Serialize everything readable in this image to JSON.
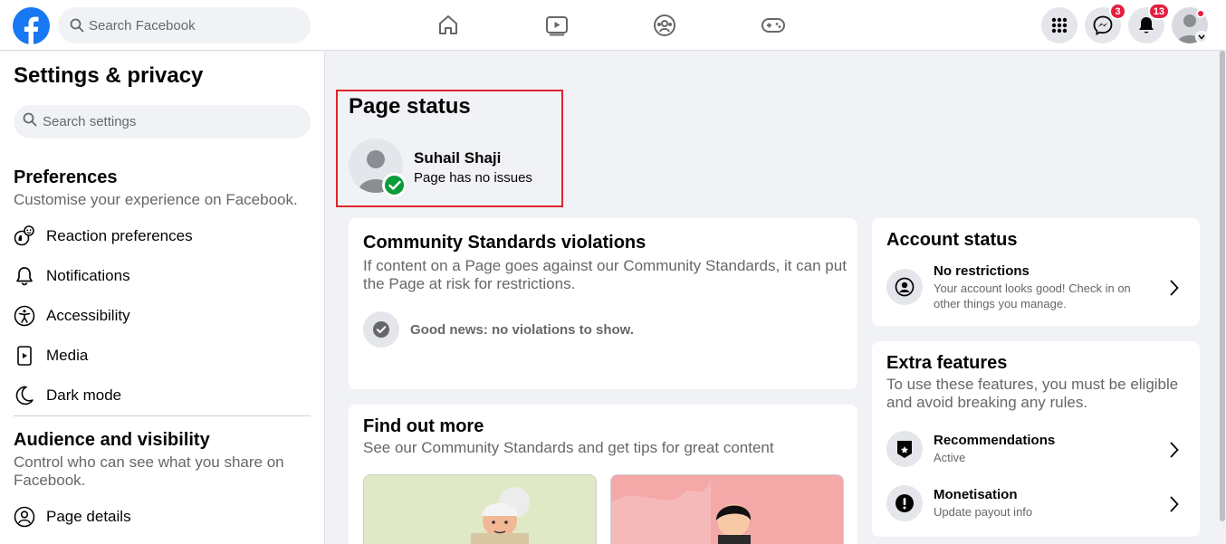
{
  "topbar": {
    "search_placeholder": "Search Facebook",
    "messenger_badge": "3",
    "notifications_badge": "13"
  },
  "sidebar": {
    "title": "Settings & privacy",
    "search_placeholder": "Search settings",
    "preferences": {
      "title": "Preferences",
      "description": "Customise your experience on Facebook.",
      "items": [
        {
          "label": "Reaction preferences",
          "icon": "reaction-icon"
        },
        {
          "label": "Notifications",
          "icon": "bell-icon"
        },
        {
          "label": "Accessibility",
          "icon": "accessibility-icon"
        },
        {
          "label": "Media",
          "icon": "media-icon"
        },
        {
          "label": "Dark mode",
          "icon": "moon-icon"
        }
      ]
    },
    "audience": {
      "title": "Audience and visibility",
      "description": "Control who can see what you share on Facebook.",
      "items": [
        {
          "label": "Page details",
          "icon": "person-icon"
        }
      ]
    }
  },
  "page_status": {
    "title": "Page status",
    "name": "Suhail Shaji",
    "status": "Page has no issues"
  },
  "community": {
    "title": "Community Standards violations",
    "description": "If content on a Page goes against our Community Standards, it can put the Page at risk for restrictions.",
    "good_news": "Good news: no violations to show."
  },
  "find_out_more": {
    "title": "Find out more",
    "description": "See our Community Standards and get tips for great content"
  },
  "account_status": {
    "title": "Account status",
    "row_title": "No restrictions",
    "row_desc": "Your account looks good! Check in on other things you manage."
  },
  "extra_features": {
    "title": "Extra features",
    "description": "To use these features, you must be eligible and avoid breaking any rules.",
    "items": [
      {
        "title": "Recommendations",
        "sub": "Active"
      },
      {
        "title": "Monetisation",
        "sub": "Update payout info"
      }
    ]
  },
  "colors": {
    "brand": "#1877f2",
    "badge": "#e41e3f",
    "success": "#0a9b3a",
    "highlight_box": "#e0242c"
  }
}
